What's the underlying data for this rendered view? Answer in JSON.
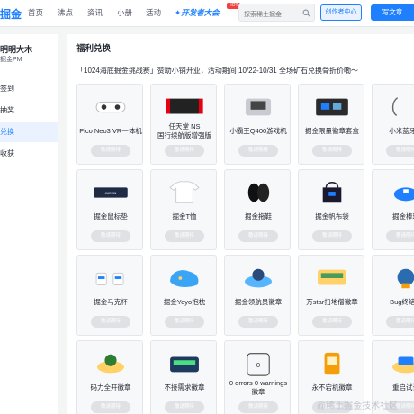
{
  "header": {
    "logo": "掘金",
    "nav": [
      "首页",
      "沸点",
      "资讯",
      "小册",
      "活动",
      "开发者大会"
    ],
    "hot_badge": "HOT",
    "search_placeholder": "探索稀土掘金",
    "creator_label": "创作者中心",
    "write_label": "写文章"
  },
  "sidebar": {
    "user_name": "明明大木",
    "user_sub": "掘金PM",
    "items": [
      {
        "label": "签到",
        "active": false
      },
      {
        "label": "抽奖",
        "active": false
      },
      {
        "label": "兑换",
        "active": true
      },
      {
        "label": "收获",
        "active": false
      }
    ]
  },
  "main": {
    "title": "福利兑换",
    "notice": "「1024海底掘金挑战赛」赞助小铺开业，活动期间 10/22-10/31 全场矿石兑换骨折价嘞～",
    "items": [
      {
        "name": "Pico Neo3 VR一体机",
        "button": "敬请期待",
        "icon": "vr-headset-icon"
      },
      {
        "name": "任天堂 NS",
        "name2": "国行续航版增强版",
        "button": "敬请期待",
        "icon": "game-console-icon"
      },
      {
        "name": "小霸王Q400游戏机",
        "button": "敬请期待",
        "icon": "handheld-console-icon"
      },
      {
        "name": "掘金限量徽章套盒",
        "button": "敬请期待",
        "icon": "badge-box-icon"
      },
      {
        "name": "小米蓝牙项",
        "button": "敬请期待",
        "icon": "earphones-icon"
      },
      {
        "name": "掘金鼠标垫",
        "button": "敬请期待",
        "icon": "mousepad-icon"
      },
      {
        "name": "掘金T恤",
        "button": "敬请期待",
        "icon": "tshirt-icon"
      },
      {
        "name": "掘金拖鞋",
        "button": "敬请期待",
        "icon": "slippers-icon"
      },
      {
        "name": "掘金帆布袋",
        "button": "敬请期待",
        "icon": "tote-bag-icon"
      },
      {
        "name": "掘金棒球",
        "button": "敬请期待",
        "icon": "cap-icon"
      },
      {
        "name": "掘金马克杯",
        "button": "敬请期待",
        "icon": "mug-icon"
      },
      {
        "name": "掘金Yoyo抱枕",
        "button": "敬请期待",
        "icon": "pillow-icon"
      },
      {
        "name": "掘金领航员徽章",
        "button": "敬请期待",
        "icon": "navigator-badge-icon"
      },
      {
        "name": "万star扫地僧徽章",
        "button": "敬请期待",
        "icon": "star-badge-icon"
      },
      {
        "name": "Bug终结者",
        "button": "敬请期待",
        "icon": "bug-badge-icon"
      },
      {
        "name": "码力全开徽章",
        "button": "敬请期待",
        "icon": "coding-badge-icon"
      },
      {
        "name": "不接需求徽章",
        "button": "敬请期待",
        "icon": "no-request-badge-icon"
      },
      {
        "name": "0 errors 0 warnings",
        "name2": "徽章",
        "button": "敬请期待",
        "icon": "zero-error-badge-icon"
      },
      {
        "name": "永不宕机徽章",
        "button": "敬请期待",
        "icon": "no-downtime-badge-icon"
      },
      {
        "name": "重启试试",
        "button": "敬请期待",
        "icon": "restart-badge-icon"
      }
    ]
  },
  "watermark": "@稀土掘金技术社区",
  "colors": {
    "accent": "#1e80ff",
    "button_disabled": "#dfe1e5"
  }
}
